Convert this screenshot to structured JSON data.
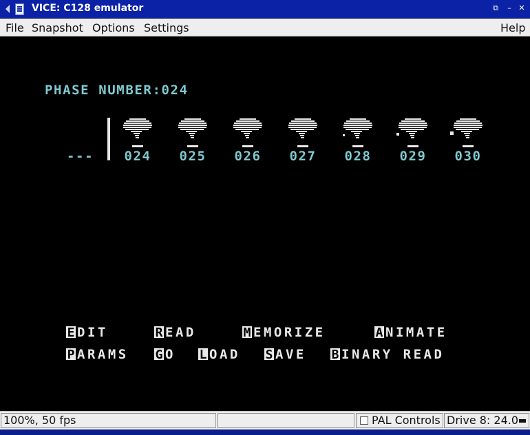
{
  "window": {
    "title": "VICE: C128 emulator"
  },
  "menu": {
    "items": [
      "File",
      "Snapshot",
      "Options",
      "Settings"
    ],
    "help": "Help"
  },
  "c128_screen": {
    "phase_label": "PHASE NUMBER:024",
    "prefix": "---",
    "frames": [
      "024",
      "025",
      "026",
      "027",
      "028",
      "029",
      "030"
    ],
    "commands_row1": [
      {
        "key": "E",
        "rest": "DIT"
      },
      {
        "key": "R",
        "rest": "EAD"
      },
      {
        "key": "M",
        "rest": "EMORIZE"
      },
      {
        "key": "A",
        "rest": "NIMATE"
      }
    ],
    "commands_row2": [
      {
        "key": "P",
        "rest": "ARAMS"
      },
      {
        "key": "G",
        "rest": "O"
      },
      {
        "key": "L",
        "rest": "OAD"
      },
      {
        "key": "S",
        "rest": "AVE"
      },
      {
        "key": "B",
        "rest": "INARY READ"
      }
    ],
    "colors": {
      "background": "#000000",
      "text_cyan": "#7ec8cf",
      "text_white": "#e8e8e8"
    }
  },
  "status": {
    "speed": "100%, 50 fps",
    "pal_controls": "PAL Controls",
    "drive": "Drive 8: 24.0"
  }
}
